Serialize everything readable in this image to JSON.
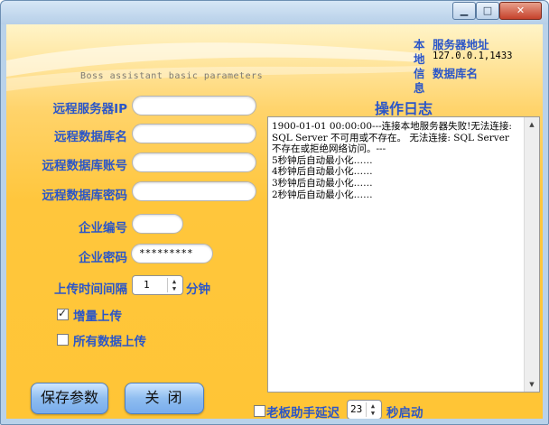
{
  "titlebar": {
    "minimize": "▁",
    "maximize": "□",
    "close": "✕"
  },
  "header": {
    "subtitle": "Boss assistant basic parameters",
    "local_label_chars": [
      "本",
      "地",
      "信",
      "息"
    ],
    "server_addr_label": "服务器地址",
    "server_addr_value": "127.0.0.1,1433",
    "db_name_label": "数据库名"
  },
  "form": {
    "remote_ip_label": "远程服务器IP",
    "remote_ip_value": "",
    "remote_db_label": "远程数据库名",
    "remote_db_value": "",
    "remote_account_label": "远程数据库账号",
    "remote_account_value": "",
    "remote_password_label": "远程数据库密码",
    "remote_password_value": "",
    "company_id_label": "企业编号",
    "company_id_value": "",
    "company_pwd_label": "企业密码",
    "company_pwd_value": "*********",
    "upload_interval_label": "上传时间间隔",
    "upload_interval_value": "1",
    "upload_interval_unit": "分钟",
    "incremental_label": "增量上传",
    "incremental_checked": true,
    "all_data_label": "所有数据上传",
    "all_data_checked": false
  },
  "log": {
    "title": "操作日志",
    "text": "1900-01-01 00:00:00---连接本地服务器失败!无法连接: SQL Server 不可用或不存在。 无法连接: SQL Server 不存在或拒绝网络访问。---\n5秒钟后自动最小化……\n4秒钟后自动最小化……\n3秒钟后自动最小化……\n2秒钟后自动最小化……"
  },
  "footer": {
    "save_label": "保存参数",
    "close_label": "关 闭",
    "delay_label": "老板助手延迟",
    "delay_value": "23",
    "delay_unit": "秒启动"
  }
}
